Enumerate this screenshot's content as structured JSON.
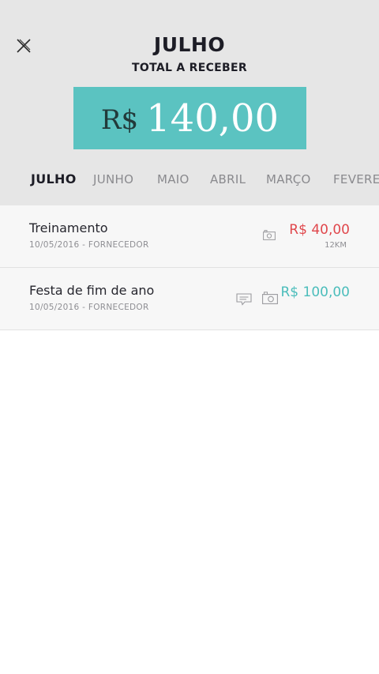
{
  "header": {
    "month": "JULHO",
    "total_label": "TOTAL A RECEBER",
    "total_currency": "R$",
    "total_value": "140,00",
    "accent_color": "#5bc3c1"
  },
  "tabs": [
    {
      "label": "JULHO",
      "active": true
    },
    {
      "label": "JUNHO",
      "active": false
    },
    {
      "label": "MAIO",
      "active": false
    },
    {
      "label": "ABRIL",
      "active": false
    },
    {
      "label": "MARÇO",
      "active": false
    },
    {
      "label": "FEVERE",
      "active": false
    }
  ],
  "items": [
    {
      "title": "Treinamento",
      "subtitle": "10/05/2016 - FORNECEDOR",
      "amount": "R$ 40,00",
      "distance": "12KM",
      "amount_color": "#e0474c",
      "icons": [
        "camera-icon"
      ]
    },
    {
      "title": "Festa de fim de ano",
      "subtitle": "10/05/2016 - FORNECEDOR",
      "amount": "R$ 100,00",
      "amount_color": "#4bbdbb",
      "icons": [
        "comment-icon",
        "camera-icon"
      ]
    }
  ]
}
